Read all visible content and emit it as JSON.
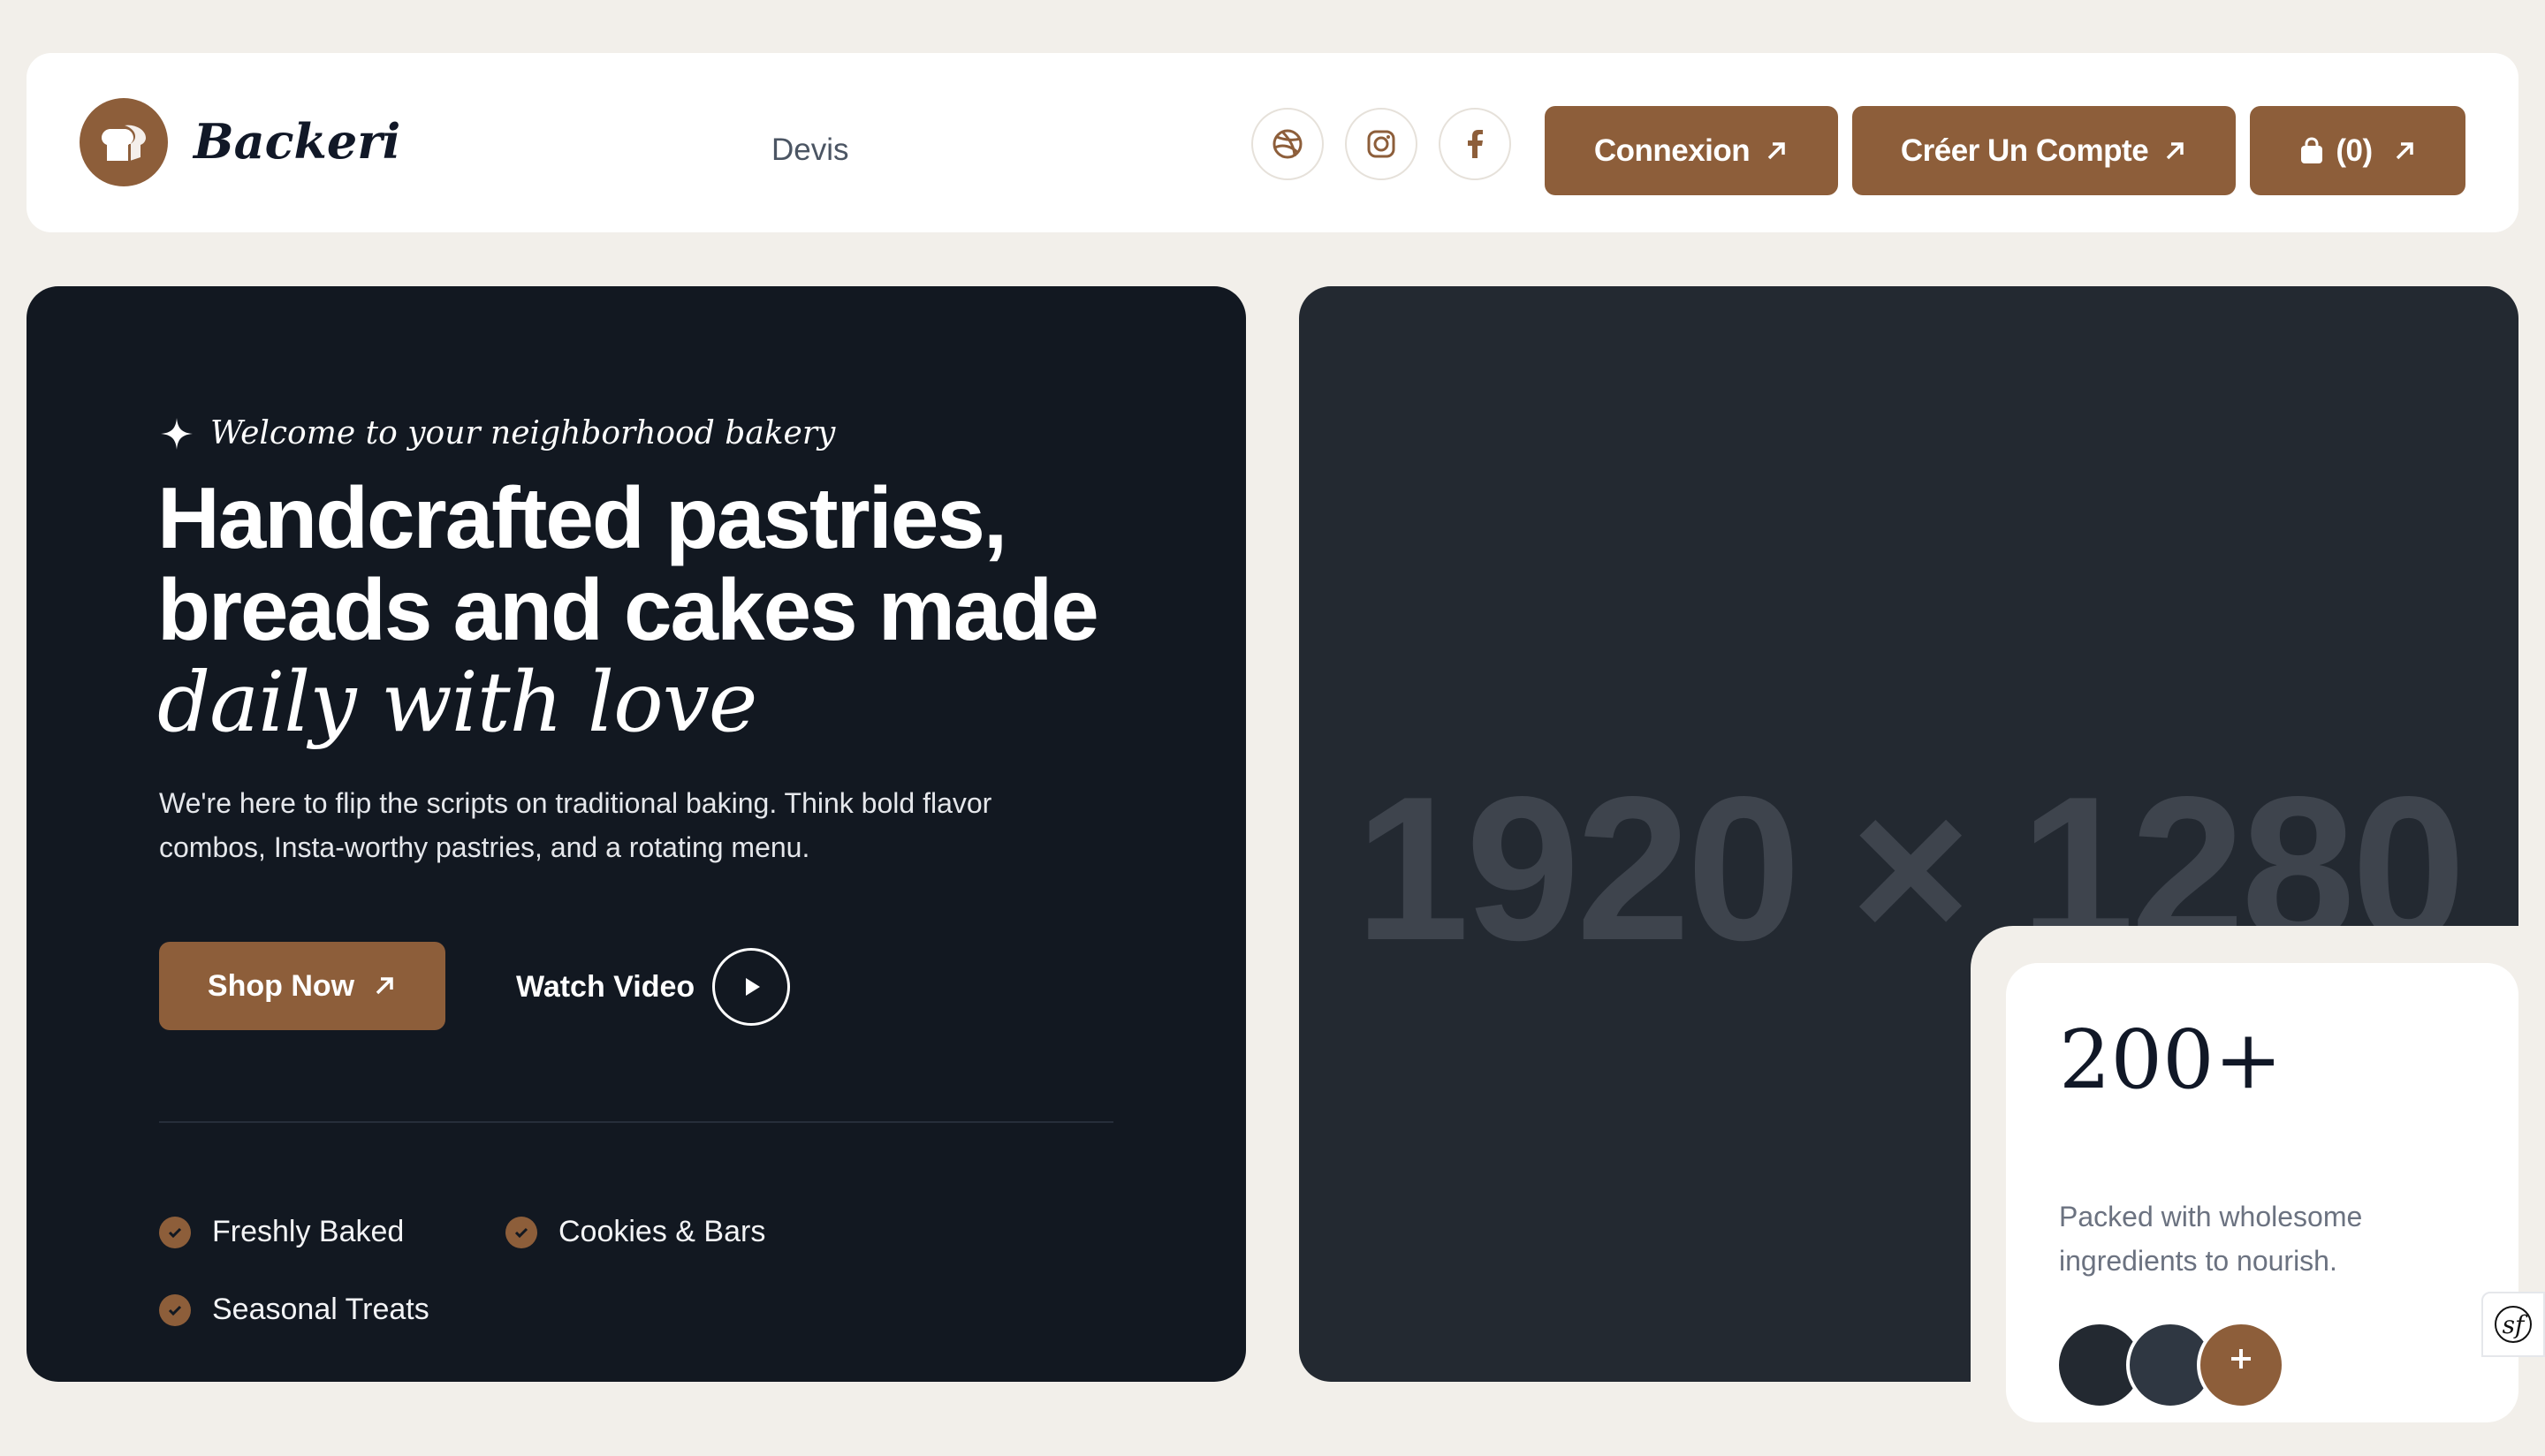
{
  "header": {
    "brand": "Backeri",
    "nav": {
      "devis": "Devis"
    },
    "social": [
      "dribbble-icon",
      "instagram-icon",
      "facebook-icon"
    ],
    "buttons": {
      "login": "Connexion",
      "signup": "Créer Un Compte",
      "cart": "(0)"
    }
  },
  "hero": {
    "tagline": "Welcome to your neighborhood bakery",
    "headline_line1": "Handcrafted pastries,",
    "headline_line2": "breads and cakes made",
    "headline_accent": "daily with love",
    "description": "We're here to flip the scripts on traditional baking. Think bold flavor combos, Insta-worthy pastries, and a rotating menu.",
    "shop_label": "Shop Now",
    "watch_label": "Watch Video",
    "features": [
      "Freshly Baked",
      "Cookies & Bars",
      "Seasonal Treats"
    ]
  },
  "image": {
    "placeholder": "1920 × 1280"
  },
  "stat": {
    "value": "200+",
    "description": "Packed with wholesome ingredients to nourish."
  },
  "corner_badge": "sf",
  "colors": {
    "brand": "#8d5e3a",
    "dark": "#121821",
    "image_bg": "#232931",
    "page_bg": "#f2efea"
  }
}
